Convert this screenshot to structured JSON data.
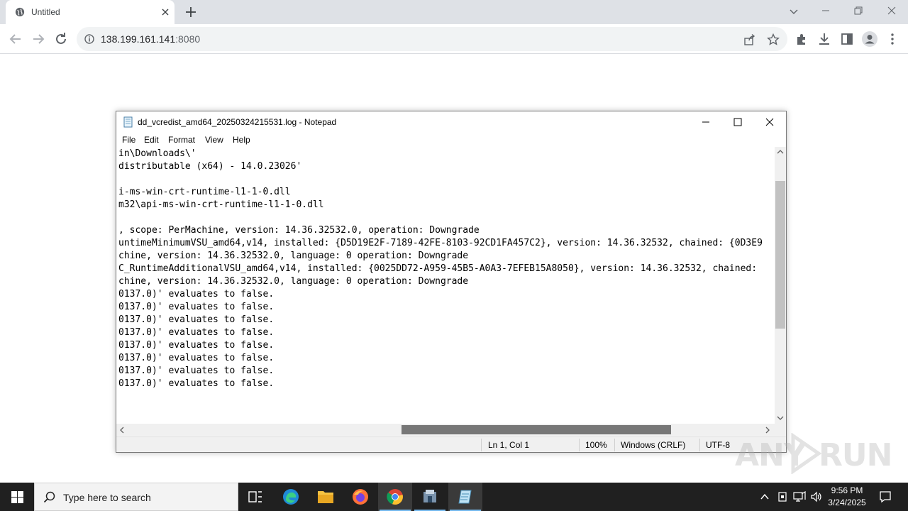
{
  "browser": {
    "tab_title": "Untitled",
    "url_host": "138.199.161.141",
    "url_port": ":8080"
  },
  "notepad": {
    "title": "dd_vcredist_amd64_20250324215531.log - Notepad",
    "menu": [
      "File",
      "Edit",
      "Format",
      "View",
      "Help"
    ],
    "lines": [
      "in\\Downloads\\'",
      "distributable (x64) - 14.0.23026'",
      "",
      "i-ms-win-crt-runtime-l1-1-0.dll",
      "m32\\api-ms-win-crt-runtime-l1-1-0.dll",
      "",
      ", scope: PerMachine, version: 14.36.32532.0, operation: Downgrade",
      "untimeMinimumVSU_amd64,v14, installed: {D5D19E2F-7189-42FE-8103-92CD1FA457C2}, version: 14.36.32532, chained: {0D3E9",
      "chine, version: 14.36.32532.0, language: 0 operation: Downgrade",
      "C_RuntimeAdditionalVSU_amd64,v14, installed: {0025DD72-A959-45B5-A0A3-7EFEB15A8050}, version: 14.36.32532, chained: ",
      "chine, version: 14.36.32532.0, language: 0 operation: Downgrade",
      "0137.0)' evaluates to false.",
      "0137.0)' evaluates to false.",
      "0137.0)' evaluates to false.",
      "0137.0)' evaluates to false.",
      "0137.0)' evaluates to false.",
      "0137.0)' evaluates to false.",
      "0137.0)' evaluates to false.",
      "0137.0)' evaluates to false."
    ],
    "status": {
      "position": "Ln 1, Col 1",
      "zoom": "100%",
      "line_ending": "Windows (CRLF)",
      "encoding": "UTF-8"
    }
  },
  "watermark": {
    "left": "ANY",
    "right": "RUN"
  },
  "taskbar": {
    "search_placeholder": "Type here to search",
    "time": "9:56 PM",
    "date": "3/24/2025"
  },
  "colors": {
    "tabstrip": "#dee1e6",
    "taskbar": "#202020",
    "accent": "#76b9ed"
  }
}
